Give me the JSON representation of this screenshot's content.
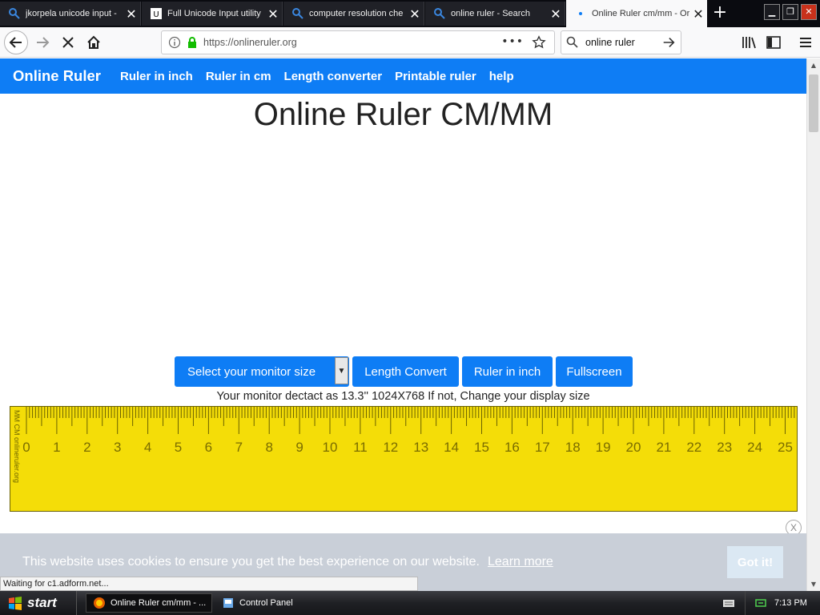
{
  "browser": {
    "tabs": [
      {
        "title": "jkorpela unicode input -",
        "icon": "search-icon",
        "active": false
      },
      {
        "title": "Full Unicode Input utility",
        "icon": "unicode-icon",
        "active": false
      },
      {
        "title": "computer resolution che",
        "icon": "search-icon",
        "active": false
      },
      {
        "title": "online ruler - Search",
        "icon": "search-icon",
        "active": false
      },
      {
        "title": "Online Ruler cm/mm - Or",
        "icon": "loading-dot-icon",
        "active": true
      }
    ],
    "url": "https://onlineruler.org",
    "search_value": "online ruler"
  },
  "site": {
    "brand": "Online Ruler",
    "nav": [
      "Ruler in inch",
      "Ruler in cm",
      "Length converter",
      "Printable ruler",
      "help"
    ],
    "title": "Online Ruler CM/MM",
    "buttons": {
      "monitor_select": "Select your monitor size",
      "length_convert": "Length Convert",
      "ruler_inch": "Ruler in inch",
      "fullscreen": "Fullscreen"
    },
    "monitor_info": "Your monitor dectact as 13.3'' 1024X768 If not, Change your display size",
    "ruler": {
      "side_label": "MM CM  onlineruler.org",
      "cm_labels": [
        "0",
        "1",
        "2",
        "3",
        "4",
        "5",
        "6",
        "7",
        "8",
        "9",
        "10",
        "11",
        "12",
        "13",
        "14",
        "15",
        "16",
        "17",
        "18",
        "19",
        "20",
        "21",
        "22",
        "23",
        "24",
        "25"
      ],
      "color": "#f4dd08"
    },
    "cookie": {
      "message": "This website uses cookies to ensure you get the best experience on our website.",
      "learn_more": "Learn more",
      "ok": "Got it!",
      "close": "X"
    }
  },
  "status_text": "Waiting for c1.adform.net...",
  "taskbar": {
    "start": "start",
    "tasks": [
      "Online Ruler cm/mm - ...",
      "Control Panel"
    ],
    "clock": "7:13 PM"
  },
  "colors": {
    "accent": "#0e7df5",
    "ruler": "#f4dd08"
  }
}
